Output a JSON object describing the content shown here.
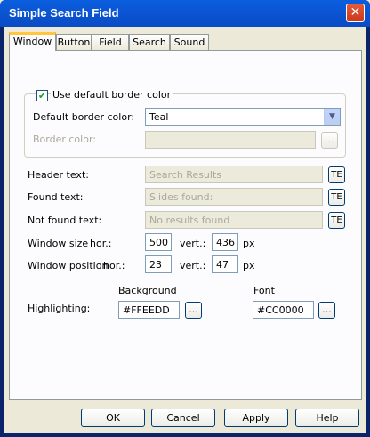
{
  "window": {
    "title": "Simple Search Field",
    "close_glyph": "✕"
  },
  "tabs": [
    "Window",
    "Button",
    "Field",
    "Search",
    "Sound"
  ],
  "group": {
    "use_default_label": "Use default border color",
    "use_default_checked": true,
    "default_border_label": "Default border color:",
    "default_border_value": "Teal",
    "border_color_label": "Border color:",
    "border_color_value": "",
    "browse_glyph": "..."
  },
  "texts": {
    "header_label": "Header text:",
    "header_value": "Search Results",
    "found_label": "Found text:",
    "found_value": "Slides found:",
    "notfound_label": "Not found text:",
    "notfound_value": "No results found",
    "te_label": "TE"
  },
  "size": {
    "label": "Window size",
    "hor_label": "hor.:",
    "hor_value": "500",
    "vert_label": "vert.:",
    "vert_value": "436",
    "unit": "px"
  },
  "position": {
    "label": "Window position",
    "hor_label": "hor.:",
    "hor_value": "23",
    "vert_label": "vert.:",
    "vert_value": "47",
    "unit": "px"
  },
  "highlighting": {
    "label": "Highlighting:",
    "background_label": "Background",
    "background_value": "#FFEEDD",
    "font_label": "Font",
    "font_value": "#CC0000",
    "browse_glyph": "..."
  },
  "buttons": {
    "ok": "OK",
    "cancel": "Cancel",
    "apply": "Apply",
    "help": "Help"
  },
  "colors": {
    "title_bar": "#0a5fde",
    "face": "#ece9d8",
    "tab_highlight": "#ffc83c"
  }
}
